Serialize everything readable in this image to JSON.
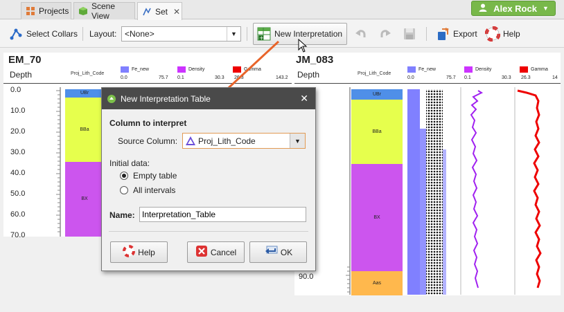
{
  "tabs": [
    {
      "label": "Projects",
      "icon": "projects-grid-icon"
    },
    {
      "label": "Scene View",
      "icon": "cube-icon"
    },
    {
      "label": "Set",
      "icon": "set-icon",
      "close": "✕"
    }
  ],
  "user": {
    "name": "Alex Rock"
  },
  "toolbar": {
    "select_collars": "Select Collars",
    "layout_label": "Layout:",
    "layout_value": "<None>",
    "new_interpretation": "New Interpretation",
    "export": "Export",
    "help": "Help"
  },
  "left_hole": {
    "name": "EM_70",
    "depth_label": "Depth",
    "column_header": "Proj_Lith_Code",
    "legends": [
      {
        "name": "Fe_new",
        "color": "#8080ff",
        "min": "0.0",
        "max": "75.7"
      },
      {
        "name": "Density",
        "color": "#cc33ff",
        "min": "0.1",
        "max": "30.3"
      },
      {
        "name": "Gamma",
        "color": "#ee0000",
        "min": "26.3",
        "max": "143.2"
      }
    ],
    "depth_ticks": [
      "0.0",
      "10.0",
      "20.0",
      "30.0",
      "40.0",
      "50.0",
      "60.0",
      "70.0"
    ],
    "lith_labels": [
      "UBr",
      "BBa",
      "BX"
    ]
  },
  "right_hole": {
    "name": "JM_083",
    "depth_label": "Depth",
    "column_header": "Proj_Lith_Code",
    "legends": [
      {
        "name": "Fe_new",
        "color": "#8080ff",
        "min": "0.0",
        "max": "75.7"
      },
      {
        "name": "Density",
        "color": "#cc33ff",
        "min": "0.1",
        "max": "30.3"
      },
      {
        "name": "Gamma",
        "color": "#ee0000",
        "min": "26.3",
        "max": "14"
      }
    ],
    "depth_ticks": [
      "90.0"
    ],
    "lith_labels": [
      "UBr",
      "BBa",
      "BX",
      "Aas"
    ]
  },
  "dialog": {
    "title": "New Interpretation Table",
    "section": "Column to interpret",
    "source_label": "Source Column:",
    "source_value": "Proj_Lith_Code",
    "initial_data_label": "Initial data:",
    "options": [
      "Empty table",
      "All intervals"
    ],
    "selected_option": 0,
    "name_label": "Name:",
    "name_value": "Interpretation_Table",
    "help": "Help",
    "cancel": "Cancel",
    "ok": "OK"
  },
  "colors": {
    "accent_arrow": "#e8642a",
    "user_button": "#78b84a",
    "lith_ubr": "#4f8fe8",
    "lith_bba": "#e6ff4d",
    "lith_bx": "#cc55ee",
    "lith_aas": "#ffb84d"
  }
}
